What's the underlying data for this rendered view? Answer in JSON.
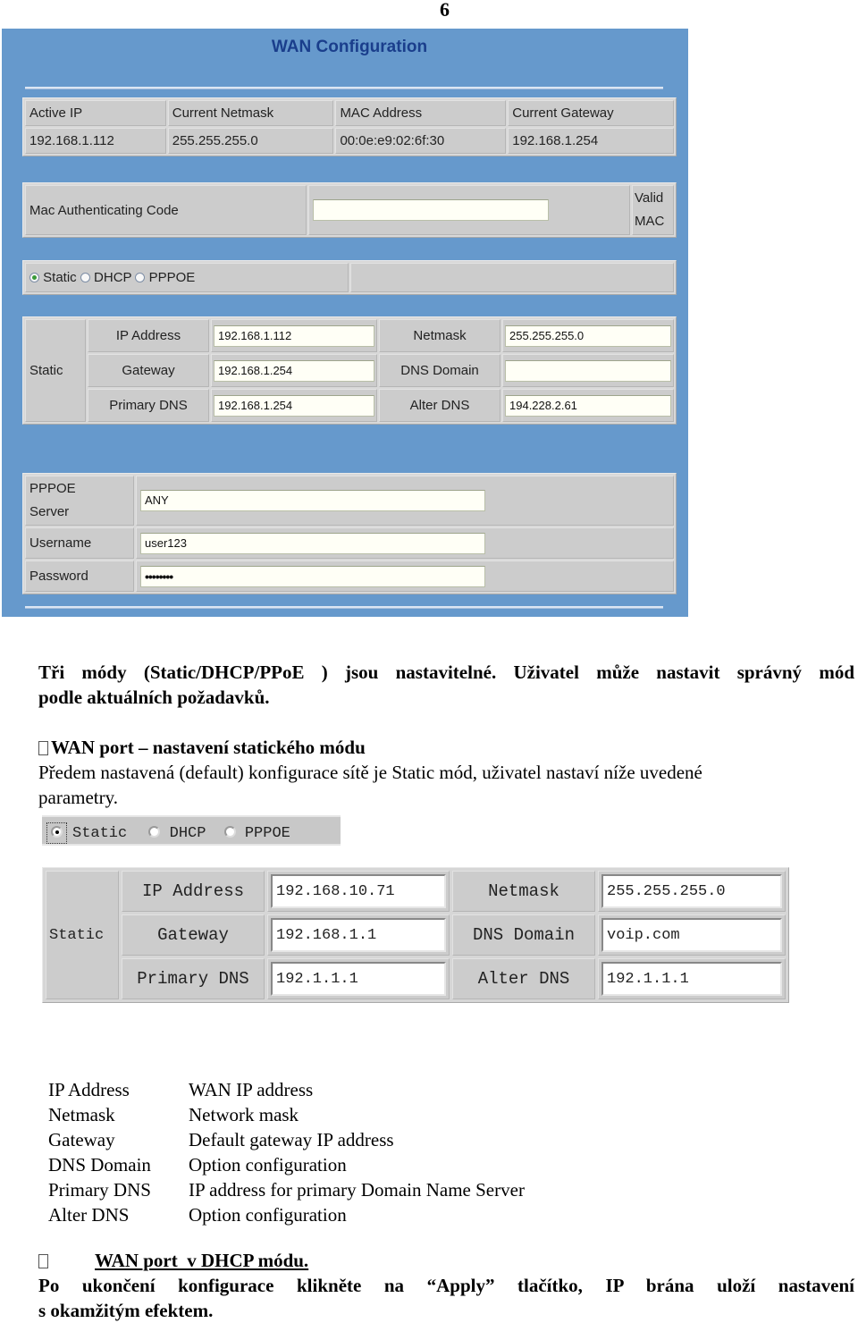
{
  "page_number": "6",
  "wan_panel": {
    "title": "WAN Configuration",
    "status_headers": [
      "Active IP",
      "Current Netmask",
      "MAC Address",
      "Current Gateway"
    ],
    "status_values": [
      "192.168.1.112",
      "255.255.255.0",
      "00:0e:e9:02:6f:30",
      "192.168.1.254"
    ],
    "mac_auth_label": "Mac Authenticating Code",
    "mac_auth_value": "",
    "valid_mac_label_line1": "Valid",
    "valid_mac_label_line2": "MAC",
    "modes": [
      {
        "label": "Static",
        "selected": true
      },
      {
        "label": "DHCP",
        "selected": false
      },
      {
        "label": "PPPOE",
        "selected": false
      }
    ],
    "static": {
      "section_label": "Static",
      "fields": [
        {
          "label": "IP Address",
          "value": "192.168.1.112"
        },
        {
          "label": "Netmask",
          "value": "255.255.255.0"
        },
        {
          "label": "Gateway",
          "value": "192.168.1.254"
        },
        {
          "label": "DNS Domain",
          "value": ""
        },
        {
          "label": "Primary DNS",
          "value": "192.168.1.254"
        },
        {
          "label": "Alter DNS",
          "value": "194.228.2.61"
        }
      ]
    },
    "pppoe": {
      "server_label_line1": "PPPOE",
      "server_label_line2": "Server",
      "server_value": "ANY",
      "username_label": "Username",
      "username_value": "user123",
      "password_label": "Password",
      "password_value": "••••••••"
    }
  },
  "text": {
    "intro_line1": "Tři módy (Static/DHCP/PPoE ) jsou nastavitelné. Uživatel může nastavit správný mód",
    "intro_line2": "podle aktuálních požadavků.",
    "static_heading": "WAN port – nastavení statického módu",
    "static_desc_line1": "Předem nastavená (default) konfigurace sítě je Static mód, uživatel nastaví níže uvedené",
    "static_desc_line2": "parametry."
  },
  "example_panel": {
    "modes": [
      {
        "label": "Static",
        "selected": true
      },
      {
        "label": "DHCP",
        "selected": false
      },
      {
        "label": "PPPOE",
        "selected": false
      }
    ],
    "section_label": "Static",
    "fields": [
      {
        "label": "IP Address",
        "value": "192.168.10.71"
      },
      {
        "label": "Netmask",
        "value": "255.255.255.0"
      },
      {
        "label": "Gateway",
        "value": "192.168.1.1"
      },
      {
        "label": "DNS Domain",
        "value": "voip.com"
      },
      {
        "label": "Primary DNS",
        "value": "192.1.1.1"
      },
      {
        "label": "Alter DNS",
        "value": "192.1.1.1"
      }
    ]
  },
  "definitions": [
    {
      "term": "IP Address",
      "desc": "WAN IP address"
    },
    {
      "term": "Netmask",
      "desc": "Network mask"
    },
    {
      "term": "Gateway",
      "desc": "Default gateway IP address"
    },
    {
      "term": "DNS Domain",
      "desc": "Option configuration"
    },
    {
      "term": "Primary DNS",
      "desc": "IP address for primary Domain Name Server"
    },
    {
      "term": "Alter DNS",
      "desc": "Option configuration"
    }
  ],
  "dhcp_section": {
    "heading": "WAN port  v DHCP módu.",
    "body_line1": "Po ukončení konfigurace klikněte na “Apply” tlačítko, IP brána uloží nastavení",
    "body_line2": "s okamžitým efektem."
  }
}
